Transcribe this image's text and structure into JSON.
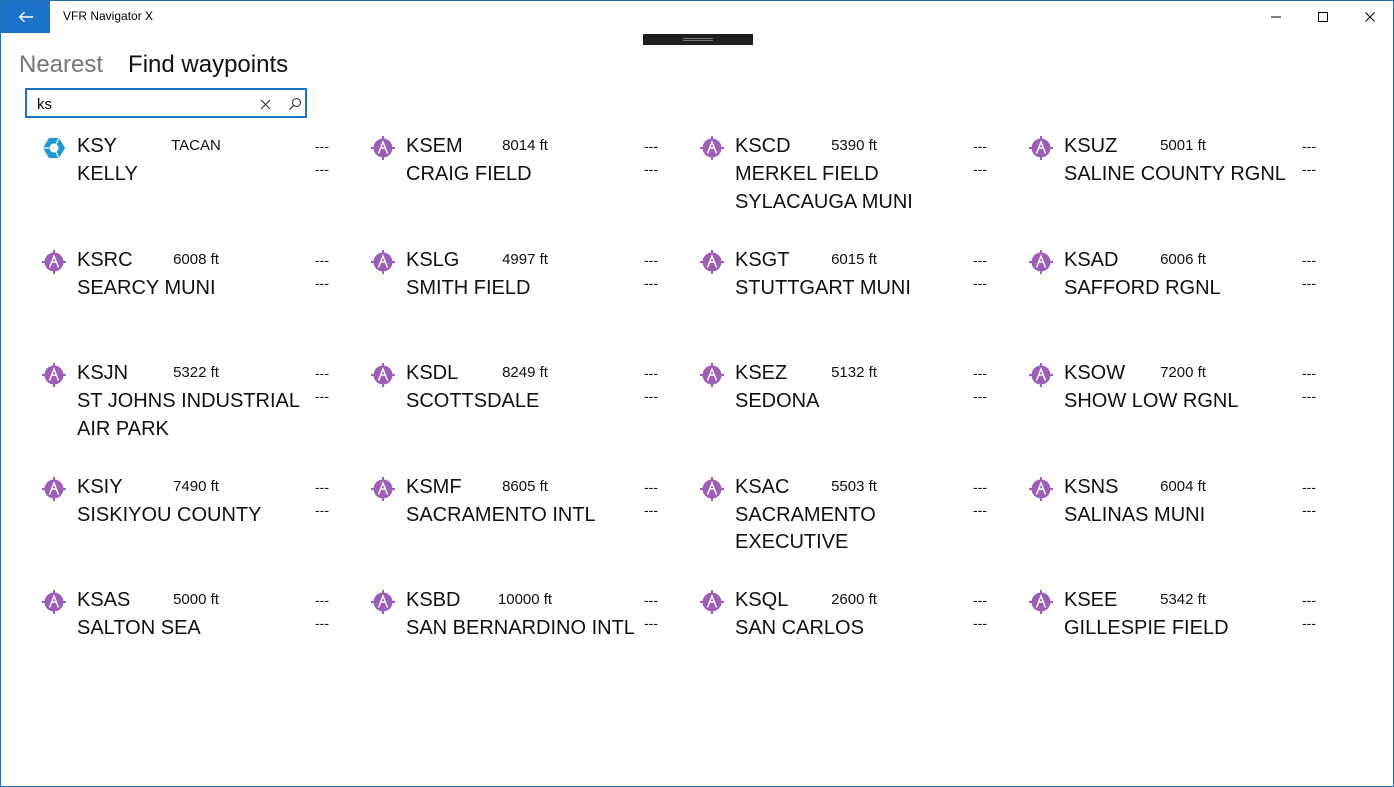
{
  "app": {
    "title": "VFR Navigator X"
  },
  "tabs": [
    {
      "label": "Nearest",
      "active": false
    },
    {
      "label": "Find waypoints",
      "active": true
    }
  ],
  "search": {
    "value": "ks",
    "placeholder": ""
  },
  "colors": {
    "accent": "#1a73c8",
    "airport_icon": "#9c5fb5",
    "tacan_icon": "#1b9ad6"
  },
  "results": [
    {
      "code": "KSY",
      "info": "TACAN",
      "name": "KELLY",
      "dist": "---",
      "brg": "---",
      "type": "tacan"
    },
    {
      "code": "KSEM",
      "info": "8014 ft",
      "name": "CRAIG FIELD",
      "dist": "---",
      "brg": "---",
      "type": "airport"
    },
    {
      "code": "KSCD",
      "info": "5390 ft",
      "name": "MERKEL FIELD SYLACAUGA MUNI",
      "dist": "---",
      "brg": "---",
      "type": "airport"
    },
    {
      "code": "KSUZ",
      "info": "5001 ft",
      "name": "SALINE COUNTY RGNL",
      "dist": "---",
      "brg": "---",
      "type": "airport"
    },
    {
      "code": "KSRC",
      "info": "6008 ft",
      "name": "SEARCY MUNI",
      "dist": "---",
      "brg": "---",
      "type": "airport"
    },
    {
      "code": "KSLG",
      "info": "4997 ft",
      "name": "SMITH FIELD",
      "dist": "---",
      "brg": "---",
      "type": "airport"
    },
    {
      "code": "KSGT",
      "info": "6015 ft",
      "name": "STUTTGART MUNI",
      "dist": "---",
      "brg": "---",
      "type": "airport"
    },
    {
      "code": "KSAD",
      "info": "6006 ft",
      "name": "SAFFORD RGNL",
      "dist": "---",
      "brg": "---",
      "type": "airport"
    },
    {
      "code": "KSJN",
      "info": "5322 ft",
      "name": "ST JOHNS INDUSTRIAL AIR PARK",
      "dist": "---",
      "brg": "---",
      "type": "airport"
    },
    {
      "code": "KSDL",
      "info": "8249 ft",
      "name": "SCOTTSDALE",
      "dist": "---",
      "brg": "---",
      "type": "airport"
    },
    {
      "code": "KSEZ",
      "info": "5132 ft",
      "name": "SEDONA",
      "dist": "---",
      "brg": "---",
      "type": "airport"
    },
    {
      "code": "KSOW",
      "info": "7200 ft",
      "name": "SHOW LOW RGNL",
      "dist": "---",
      "brg": "---",
      "type": "airport"
    },
    {
      "code": "KSIY",
      "info": "7490 ft",
      "name": "SISKIYOU COUNTY",
      "dist": "---",
      "brg": "---",
      "type": "airport"
    },
    {
      "code": "KSMF",
      "info": "8605 ft",
      "name": "SACRAMENTO INTL",
      "dist": "---",
      "brg": "---",
      "type": "airport"
    },
    {
      "code": "KSAC",
      "info": "5503 ft",
      "name": "SACRAMENTO EXECUTIVE",
      "dist": "---",
      "brg": "---",
      "type": "airport"
    },
    {
      "code": "KSNS",
      "info": "6004 ft",
      "name": "SALINAS MUNI",
      "dist": "---",
      "brg": "---",
      "type": "airport"
    },
    {
      "code": "KSAS",
      "info": "5000 ft",
      "name": "SALTON SEA",
      "dist": "---",
      "brg": "---",
      "type": "airport"
    },
    {
      "code": "KSBD",
      "info": "10000 ft",
      "name": "SAN BERNARDINO INTL",
      "dist": "---",
      "brg": "---",
      "type": "airport"
    },
    {
      "code": "KSQL",
      "info": "2600 ft",
      "name": "SAN CARLOS",
      "dist": "---",
      "brg": "---",
      "type": "airport"
    },
    {
      "code": "KSEE",
      "info": "5342 ft",
      "name": "GILLESPIE FIELD",
      "dist": "---",
      "brg": "---",
      "type": "airport"
    }
  ]
}
